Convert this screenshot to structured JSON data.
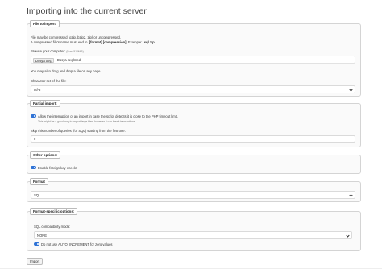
{
  "page": {
    "title": "Importing into the current server"
  },
  "file_to_import": {
    "legend": "File to import:",
    "compress_note": "File may be compressed (gzip, bzip2, zip) or uncompressed.",
    "name_note_prefix": "A compressed file's name must end in",
    "name_note_format": ".[format].[compression]",
    "name_note_example_prefix": ". Example:",
    "name_note_example": ".sql.zip",
    "browse_label": "Browse your computer:",
    "max_size": "(Max: 512MiB)",
    "choose_button": "Dosya Seç",
    "chosen_file": "Dosya seçilmedi",
    "drag_hint": "You may also drag and drop a file on any page.",
    "charset_label": "Character set of the file:",
    "charset_value": "utf-8"
  },
  "partial_import": {
    "legend": "Partial import:",
    "allow_interrupt_label": "Allow the interruption of an import in case the script detects it is close to the PHP timeout limit.",
    "allow_interrupt_hint": "This might be a good way to import large files, however it can break transactions.",
    "skip_label": "Skip this number of queries (for SQL) starting from the first one:",
    "skip_value": "0"
  },
  "other_options": {
    "legend": "Other options:",
    "foreign_keys_label": "Enable foreign key checks"
  },
  "format": {
    "legend": "Format",
    "value": "SQL"
  },
  "format_specific": {
    "legend": "Format-specific options:",
    "compat_label": "SQL compatibility mode:",
    "compat_value": "NONE",
    "auto_increment_label": "Do not use AUTO_INCREMENT for zero values"
  },
  "actions": {
    "import_label": "Import"
  },
  "colors": {
    "toggle_on": "#2f73d6",
    "panel_bg": "#fafafa",
    "border": "#d4d4d4"
  }
}
